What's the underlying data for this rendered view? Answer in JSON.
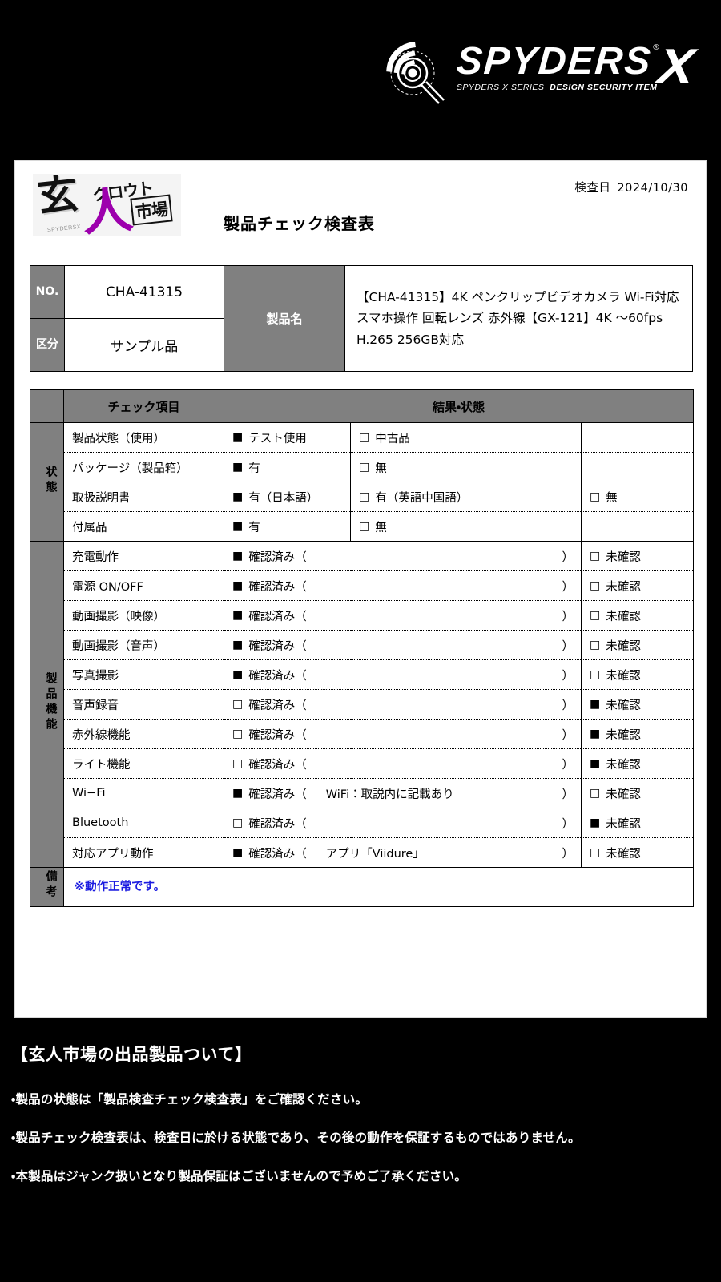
{
  "brand": {
    "name": "SPYDERS",
    "x_mark": "X",
    "registered": "®",
    "tagline_series": "SPYDERS X SERIES",
    "tagline_item": "DESIGN SECURITY ITEM"
  },
  "shop_logo": {
    "gen": "玄",
    "hito": "人",
    "kurouto": "クロウト",
    "ichiba": "市場",
    "tiny": "SPYDERSX"
  },
  "header": {
    "title": "製品チェック検査表",
    "date_label": "検査日",
    "date_value": "2024/10/30"
  },
  "info": {
    "no_label": "NO.",
    "no_value": "CHA-41315",
    "kubun_label": "区分",
    "kubun_value": "サンプル品",
    "name_label": "製品名",
    "name_value": "【CHA-41315】4K ペンクリップビデオカメラ Wi-Fi対応 スマホ操作 回転レンズ 赤外線【GX-121】4K 〜60fps H.265 256GB対応"
  },
  "table": {
    "col_item": "チェック項目",
    "col_result": "結果・状態",
    "section_status": "状態",
    "section_function": "製品機能",
    "section_remark": "備考",
    "checked": "■",
    "unchecked": "□",
    "status_rows": [
      {
        "item": "製品状態（使用）",
        "opt1": {
          "box": "■",
          "label": "テスト使用"
        },
        "opt2": {
          "box": "□",
          "label": "中古品"
        },
        "opt3": {
          "box": "",
          "label": ""
        }
      },
      {
        "item": "パッケージ（製品箱）",
        "opt1": {
          "box": "■",
          "label": "有"
        },
        "opt2": {
          "box": "□",
          "label": "無"
        },
        "opt3": {
          "box": "",
          "label": ""
        }
      },
      {
        "item": "取扱説明書",
        "opt1": {
          "box": "■",
          "label": "有（日本語）"
        },
        "opt2": {
          "box": "□",
          "label": "有（英語中国語）"
        },
        "opt3": {
          "box": "□",
          "label": "無"
        }
      },
      {
        "item": "付属品",
        "opt1": {
          "box": "■",
          "label": "有"
        },
        "opt2": {
          "box": "□",
          "label": "無"
        },
        "opt3": {
          "box": "",
          "label": ""
        }
      }
    ],
    "confirm_label": "確認済み",
    "paren_open": "（",
    "paren_close": "）",
    "unconfirmed_label": "未確認",
    "function_rows": [
      {
        "item": "充電動作",
        "confirm_box": "■",
        "note": "",
        "unconfirm_box": "□"
      },
      {
        "item": "電源 ON/OFF",
        "confirm_box": "■",
        "note": "",
        "unconfirm_box": "□"
      },
      {
        "item": "動画撮影（映像）",
        "confirm_box": "■",
        "note": "",
        "unconfirm_box": "□"
      },
      {
        "item": "動画撮影（音声）",
        "confirm_box": "■",
        "note": "",
        "unconfirm_box": "□"
      },
      {
        "item": "写真撮影",
        "confirm_box": "■",
        "note": "",
        "unconfirm_box": "□"
      },
      {
        "item": "音声録音",
        "confirm_box": "□",
        "note": "",
        "unconfirm_box": "■"
      },
      {
        "item": "赤外線機能",
        "confirm_box": "□",
        "note": "",
        "unconfirm_box": "■"
      },
      {
        "item": "ライト機能",
        "confirm_box": "□",
        "note": "",
        "unconfirm_box": "■"
      },
      {
        "item": "Wi−Fi",
        "confirm_box": "■",
        "note": "WiFi：取説内に記載あり",
        "unconfirm_box": "□"
      },
      {
        "item": "Bluetooth",
        "confirm_box": "□",
        "note": "",
        "unconfirm_box": "■"
      },
      {
        "item": "対応アプリ動作",
        "confirm_box": "■",
        "note": "アプリ「Viidure」",
        "unconfirm_box": "□"
      }
    ],
    "remark_text": "※動作正常です。"
  },
  "footer": {
    "heading": "【玄人市場の出品製品ついて】",
    "notes": [
      "・製品の状態は「製品検査チェック検査表」をご確認ください。",
      "・製品チェック検査表は、検査日に於ける状態であり、その後の動作を保証するものではありません。",
      "・本製品はジャンク扱いとなり製品保証はございませんので予めご了承ください。"
    ]
  },
  "colors": {
    "background": "#000000",
    "card": "#ffffff",
    "header_gray": "#808080",
    "remark_blue": "#1b1be0",
    "logo_purple": "#9d00ad"
  }
}
